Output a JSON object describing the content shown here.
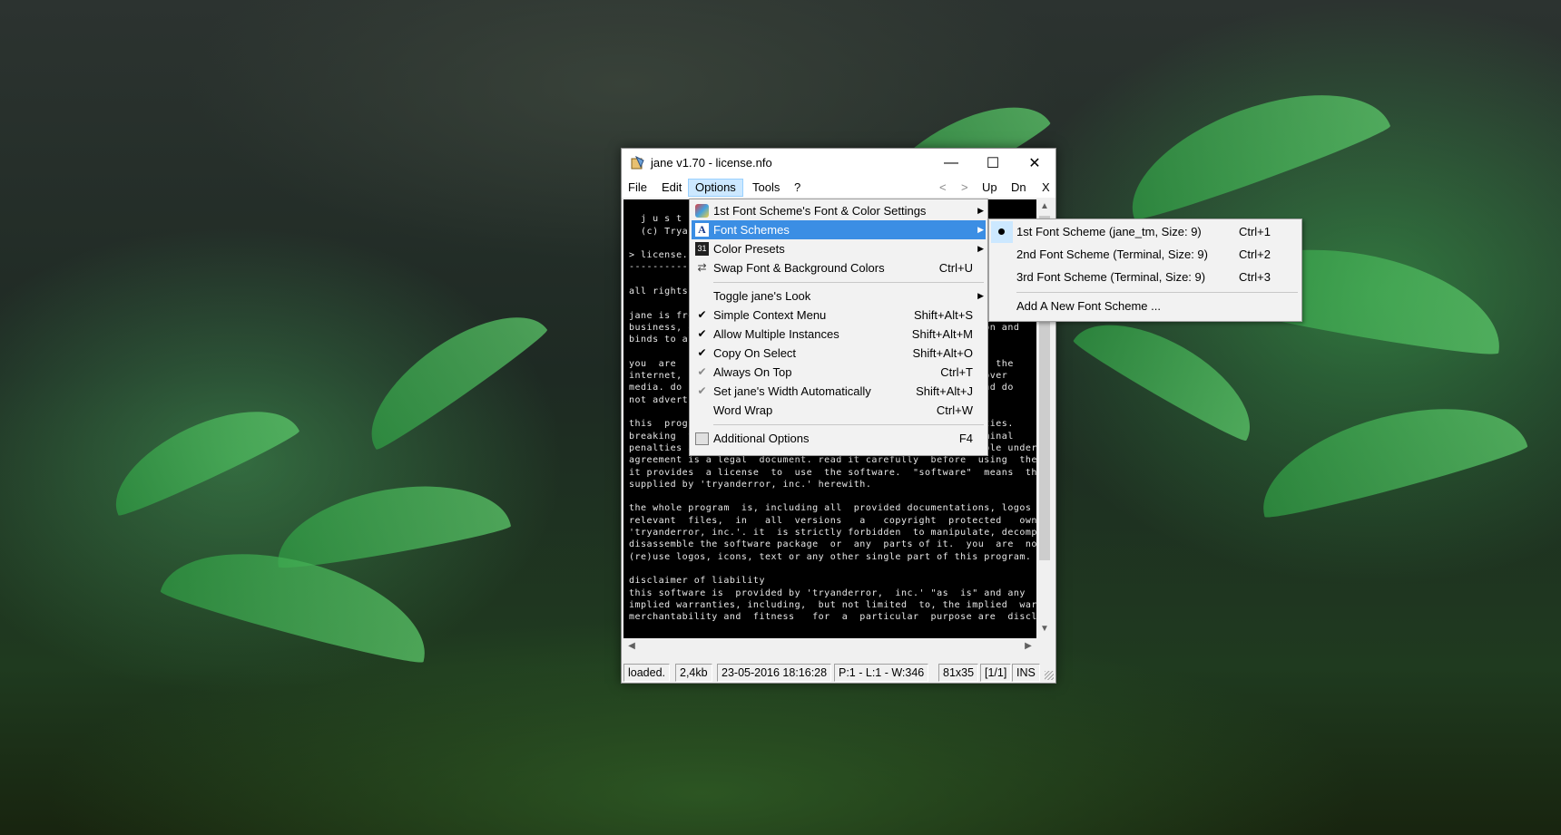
{
  "window": {
    "title": "jane v1.70 - license.nfo",
    "minimize": "—",
    "maximize": "☐",
    "close": "✕"
  },
  "menubar": {
    "file": "File",
    "edit": "Edit",
    "options": "Options",
    "tools": "Tools",
    "help": "?",
    "back": "<",
    "forward": ">",
    "up": "Up",
    "dn": "Dn",
    "x": "X"
  },
  "editor": {
    "text": "\n  j u s t\n  (c) Tryan\n\n> license.nf\n------------\n\nall rights r\n\njane is free\nbusiness, ot                                              tion and\nbinds to an\n\nyou  are  no                                              gh  the\ninternet, bb                                             e cover\nmedia. do no                                             s and do\nnot advertis                                              .\n\nthis  progr                                              reaties.\nbreaking  th                                             criminal\npenalties and will be prosecuted to the maximum extent possible under law. this\nagreement is a legal  document. read it carefully  before  using  the software.\nit provides  a license  to  use  the software.  \"software\"  means  the program\nsupplied by 'tryanderror, inc.' herewith.\n\nthe whole program  is, including all  provided documentations, logos  and other\nrelevant  files,  in   all  versions   a   copyright  protected   ownership  of\n'tryanderror, inc.'. it  is strictly forbidden  to manipulate, decompile  or to\ndisassemble the software package  or  any  parts of it.  you  are  not allowed to\n(re)use logos, icons, text or any other single part of this program.\n\ndisclaimer of liability\nthis software is  provided by 'tryanderror,  inc.' \"as  is\" and any  express or\nimplied warranties, including,  but not limited  to, the implied  warranties of\nmerchantability and  fitness   for  a  particular  purpose are  disclaimed.   in"
  },
  "statusbar": {
    "state": "loaded.",
    "size": "2,4kb",
    "date": "23-05-2016 18:16:28",
    "position": "P:1 - L:1 - W:346",
    "dims": "81x35",
    "page": "[1/1]",
    "mode": "INS"
  },
  "options_menu": {
    "items": [
      {
        "label": "1st Font Scheme's Font & Color Settings",
        "shortcut": ""
      },
      {
        "label": "Font Schemes",
        "shortcut": ""
      },
      {
        "label": "Color Presets",
        "shortcut": ""
      },
      {
        "label": "Swap Font & Background Colors",
        "shortcut": "Ctrl+U"
      },
      {
        "label": "Toggle jane's Look",
        "shortcut": ""
      },
      {
        "label": "Simple Context Menu",
        "shortcut": "Shift+Alt+S"
      },
      {
        "label": "Allow Multiple Instances",
        "shortcut": "Shift+Alt+M"
      },
      {
        "label": "Copy On Select",
        "shortcut": "Shift+Alt+O"
      },
      {
        "label": "Always On Top",
        "shortcut": "Ctrl+T"
      },
      {
        "label": "Set jane's Width Automatically",
        "shortcut": "Shift+Alt+J"
      },
      {
        "label": "Word Wrap",
        "shortcut": "Ctrl+W"
      },
      {
        "label": "Additional Options",
        "shortcut": "F4"
      }
    ]
  },
  "font_schemes_submenu": {
    "items": [
      {
        "label": "1st Font Scheme (jane_tm, Size: 9)",
        "shortcut": "Ctrl+1"
      },
      {
        "label": "2nd Font Scheme (Terminal, Size: 9)",
        "shortcut": "Ctrl+2"
      },
      {
        "label": "3rd Font Scheme (Terminal, Size: 9)",
        "shortcut": "Ctrl+3"
      },
      {
        "label": "Add A New Font Scheme ...",
        "shortcut": ""
      }
    ]
  },
  "colors": {
    "highlight": "#3b8ee4",
    "menu_active": "#cce8ff"
  }
}
